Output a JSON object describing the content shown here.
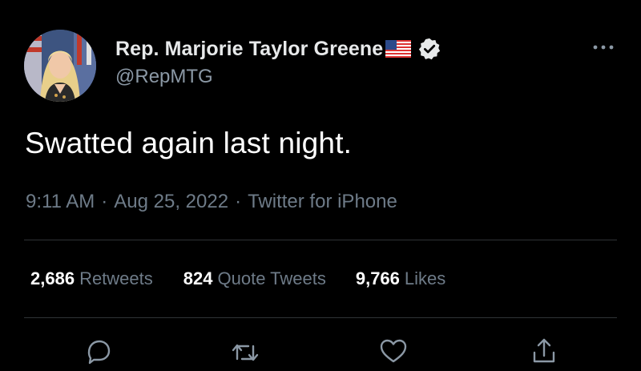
{
  "author": {
    "display_name": "Rep. Marjorie Taylor Greene",
    "handle": "@RepMTG",
    "flag": "us-flag-icon",
    "verified": "verified-badge-icon"
  },
  "tweet": {
    "text": "Swatted again last night."
  },
  "meta": {
    "time": "9:11 AM",
    "separator1": "·",
    "date": "Aug 25, 2022",
    "separator2": "·",
    "source": "Twitter for iPhone"
  },
  "stats": {
    "retweets": {
      "count": "2,686",
      "label": "Retweets"
    },
    "quote_tweets": {
      "count": "824",
      "label": "Quote Tweets"
    },
    "likes": {
      "count": "9,766",
      "label": "Likes"
    }
  },
  "actions": [
    "reply-icon",
    "retweet-icon",
    "like-icon",
    "share-icon"
  ],
  "colors": {
    "background": "#000000",
    "primary_text": "#e7e9ea",
    "secondary_text": "#6e7b88",
    "divider": "#2f3336"
  }
}
